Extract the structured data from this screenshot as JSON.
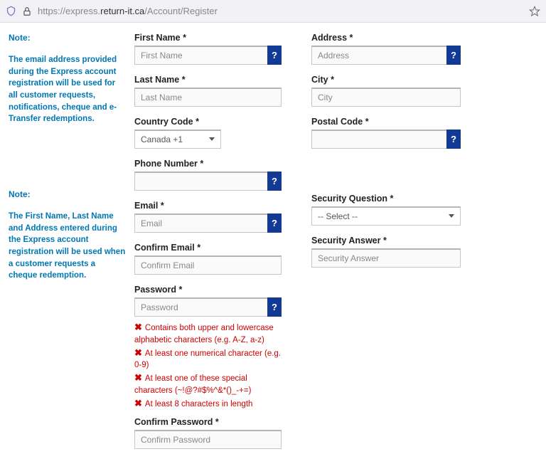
{
  "addressbar": {
    "url_prefix": "https://express.",
    "url_host": "return-it.ca",
    "url_path": "/Account/Register"
  },
  "notes": {
    "hdr1": "Note:",
    "txt1": "The email address provided during the Express account registration will be used for all customer requests, notifications, cheque and e-Transfer redemptions.",
    "hdr2": "Note:",
    "txt2": "The First Name, Last Name and Address entered during the Express account registration will be used when a customer requests a cheque redemption."
  },
  "labels": {
    "first_name": "First Name *",
    "last_name": "Last Name *",
    "country_code": "Country Code *",
    "phone": "Phone Number *",
    "email": "Email *",
    "confirm_email": "Confirm Email *",
    "password": "Password *",
    "confirm_password": "Confirm Password *",
    "address": "Address *",
    "city": "City *",
    "postal": "Postal Code *",
    "sec_q": "Security Question *",
    "sec_a": "Security Answer *"
  },
  "placeholders": {
    "first_name": "First Name",
    "last_name": "Last Name",
    "email": "Email",
    "confirm_email": "Confirm Email",
    "password": "Password",
    "confirm_password": "Confirm Password",
    "address": "Address",
    "city": "City",
    "sec_a": "Security Answer"
  },
  "values": {
    "country_code": "Canada +1",
    "sec_q": "-- Select --"
  },
  "help_icon": "?",
  "rule_x": "✖",
  "rules": {
    "r1": "Contains both upper and lowercase alphabetic characters (e.g. A-Z, a-z)",
    "r2": "At least one numerical character (e.g. 0-9)",
    "r3": "At least one of these special characters (~!@?#$%^&*()_-+=)",
    "r4": "At least 8 characters in length"
  }
}
